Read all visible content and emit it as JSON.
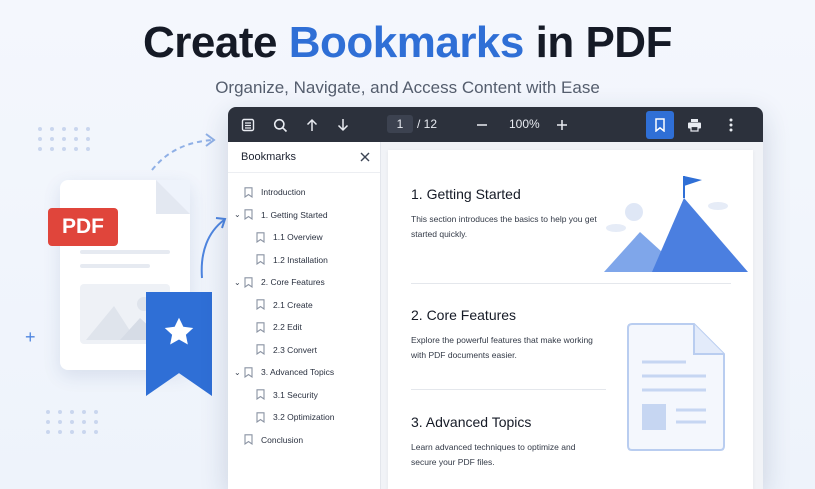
{
  "hero": {
    "title_main": "Create ",
    "title_accent": "Bookmarks",
    "title_end": " in PDF",
    "subtitle": "Organize, Navigate, and Access Content with Ease"
  },
  "illustration": {
    "badge": "PDF"
  },
  "toolbar": {
    "current_page": "1",
    "total_pages": "/ 12",
    "zoom": "100%",
    "icons": [
      "sidebar-icon",
      "search-icon",
      "arrow-up-icon",
      "arrow-down-icon",
      "zoom-out-icon",
      "zoom-in-icon",
      "bookmark-icon",
      "print-icon",
      "more-icon"
    ]
  },
  "sidebar": {
    "title": "Bookmarks",
    "items": [
      {
        "label": "Introduction",
        "level": 0,
        "expandable": false
      },
      {
        "label": "1. Getting Started",
        "level": 0,
        "expandable": true
      },
      {
        "label": "1.1 Overview",
        "level": 1,
        "expandable": false
      },
      {
        "label": "1.2 Installation",
        "level": 1,
        "expandable": false
      },
      {
        "label": "2. Core Features",
        "level": 0,
        "expandable": true
      },
      {
        "label": "2.1 Create",
        "level": 1,
        "expandable": false
      },
      {
        "label": "2.2 Edit",
        "level": 1,
        "expandable": false
      },
      {
        "label": "2.3 Convert",
        "level": 1,
        "expandable": false
      },
      {
        "label": "3. Advanced Topics",
        "level": 0,
        "expandable": true
      },
      {
        "label": "3.1 Security",
        "level": 1,
        "expandable": false
      },
      {
        "label": "3.2 Optimization",
        "level": 1,
        "expandable": false
      },
      {
        "label": "Conclusion",
        "level": 0,
        "expandable": false
      }
    ]
  },
  "content": {
    "sections": [
      {
        "heading": "1. Getting Started",
        "body": "This section introduces the basics to help you get started quickly."
      },
      {
        "heading": "2. Core Features",
        "body": "Explore the powerful features that make working with PDF documents easier."
      },
      {
        "heading": "3. Advanced Topics",
        "body": "Learn advanced techniques to optimize and secure your PDF files."
      }
    ]
  },
  "colors": {
    "accent": "#2f6fd6",
    "toolbar": "#2c313c",
    "pdf_red": "#e0453b"
  }
}
